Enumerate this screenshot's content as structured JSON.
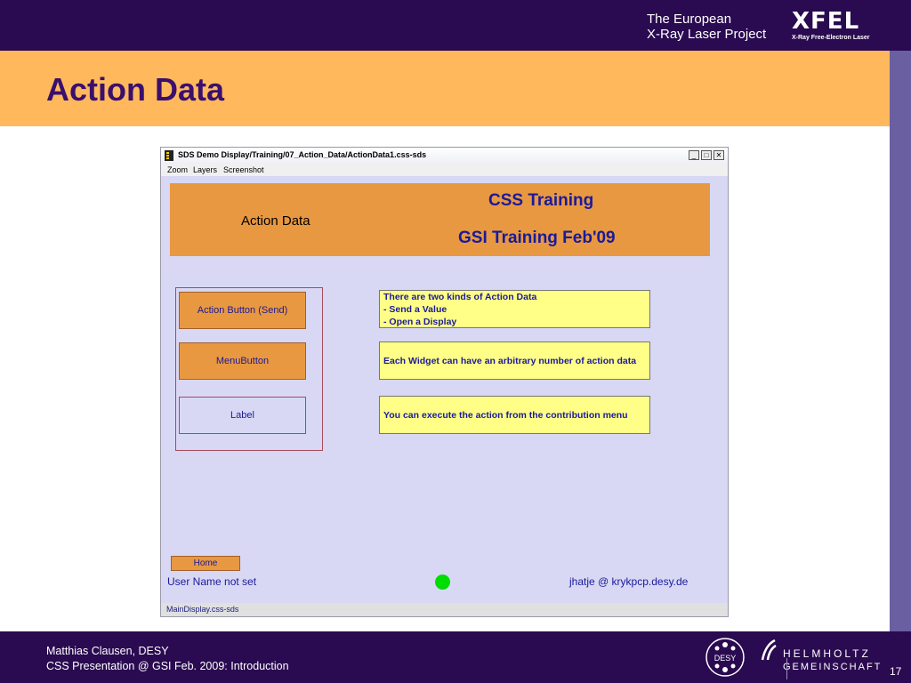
{
  "slide": {
    "project_line1": "The European",
    "project_line2": "X-Ray Laser Project",
    "logo_word": "XFEL",
    "logo_sub": "X-Ray Free-Electron Laser",
    "title": "Action Data",
    "footer_line1": "Matthias Clausen, DESY",
    "footer_line2": "CSS Presentation @ GSI Feb. 2009: Introduction",
    "desy_logo_text": "DESY",
    "helmholtz_top": "HELMHOLTZ",
    "helmholtz_bottom": "GEMEINSCHAFT",
    "page_number": "17"
  },
  "window": {
    "title": "SDS Demo Display/Training/07_Action_Data/ActionData1.css-sds",
    "controls": [
      "_",
      "□",
      "✕"
    ],
    "menu": [
      "Zoom",
      "Layers",
      "Screenshot"
    ],
    "status": "MainDisplay.css-sds"
  },
  "display": {
    "header_label": "Action Data",
    "header_training": "CSS Training",
    "header_date": "GSI Training Feb'09",
    "action_button": "Action Button (Send)",
    "menu_button": "MenuButton",
    "label_widget": "Label",
    "notes": [
      [
        "There are two kinds of Action Data",
        "- Send a Value",
        "- Open a Display"
      ],
      [
        "Each Widget can have an arbitrary number of action data"
      ],
      [
        "You can execute the action from the contribution menu"
      ]
    ],
    "home_button": "Home",
    "user_name": "User Name not set",
    "host": "jhatje @ krykpcp.desy.de"
  },
  "colors": {
    "slide_dark": "#2a0a50",
    "slide_orange": "#ffb95c",
    "title_purple": "#3a0f6e",
    "widget_orange": "#e89840",
    "widget_text": "#1a1a9a",
    "note_yellow": "#ffff88",
    "led_green": "#00dd00"
  }
}
